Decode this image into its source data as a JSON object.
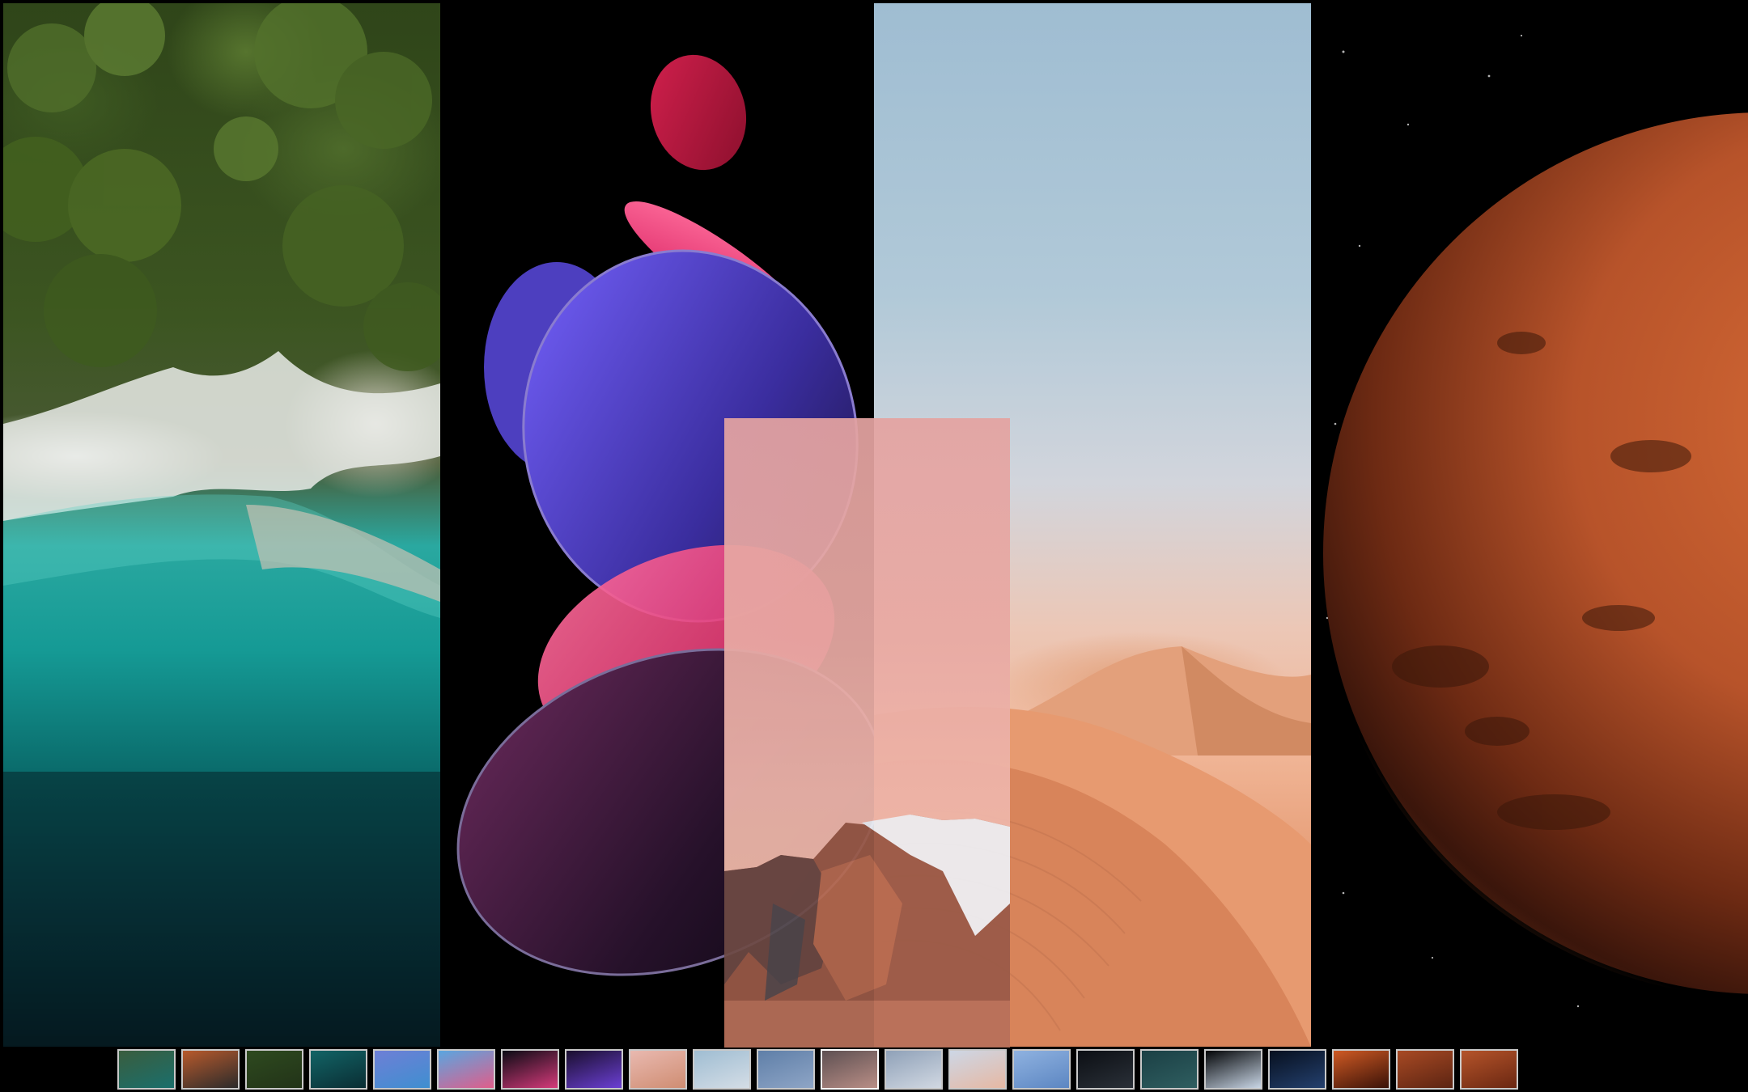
{
  "viewer": {
    "wallpapers": [
      {
        "id": "coast",
        "icon": "aerial-coast-wallpaper"
      },
      {
        "id": "discs",
        "icon": "glass-discs-wallpaper"
      },
      {
        "id": "desert",
        "icon": "desert-dunes-wallpaper"
      },
      {
        "id": "mars",
        "icon": "mars-planet-wallpaper"
      },
      {
        "id": "mountain",
        "icon": "mountain-peak-wallpaper"
      }
    ],
    "thumbnails": [
      {
        "scene": "coast-cliff",
        "colors": [
          "#3a5d3e",
          "#1a6f6c"
        ]
      },
      {
        "scene": "mars-swirl",
        "colors": [
          "#b85a2c",
          "#2b2b2b"
        ]
      },
      {
        "scene": "forest",
        "colors": [
          "#2e4a1f",
          "#223318"
        ]
      },
      {
        "scene": "teal-water",
        "colors": [
          "#126466",
          "#0a2d33"
        ]
      },
      {
        "scene": "discs-blue",
        "colors": [
          "#6e7fd6",
          "#3f8fd0"
        ]
      },
      {
        "scene": "discs-pink-blue",
        "colors": [
          "#5aa6e0",
          "#e05d8a"
        ]
      },
      {
        "scene": "discs-dark",
        "colors": [
          "#0b0b14",
          "#d53a7a"
        ]
      },
      {
        "scene": "discs-purple",
        "colors": [
          "#1a0f2e",
          "#6b3fd4"
        ]
      },
      {
        "scene": "desert-pink",
        "colors": [
          "#e9b9b0",
          "#cf8d72"
        ]
      },
      {
        "scene": "sky-blue",
        "colors": [
          "#9fbdd2",
          "#d4dde6"
        ]
      },
      {
        "scene": "blue-gray",
        "colors": [
          "#5f7fa8",
          "#8ea5c6"
        ]
      },
      {
        "scene": "dusk-lake",
        "colors": [
          "#5e5052",
          "#b98e86"
        ]
      },
      {
        "scene": "pale-sky",
        "colors": [
          "#8fa1b8",
          "#d1d8e2"
        ]
      },
      {
        "scene": "pink-sand",
        "colors": [
          "#cdd7e6",
          "#e6b8a3"
        ]
      },
      {
        "scene": "blue-dunes",
        "colors": [
          "#8fb2e0",
          "#5c86c2"
        ]
      },
      {
        "scene": "dark-dune",
        "colors": [
          "#0c0f14",
          "#2a3038"
        ]
      },
      {
        "scene": "teal-rocks",
        "colors": [
          "#1b4045",
          "#2f5e60"
        ]
      },
      {
        "scene": "planet-arc",
        "colors": [
          "#030507",
          "#c9d6e6"
        ]
      },
      {
        "scene": "night-planet",
        "colors": [
          "#07101f",
          "#24406e"
        ]
      },
      {
        "scene": "mars-orange",
        "colors": [
          "#cf5a24",
          "#3a1208"
        ]
      },
      {
        "scene": "mars-rust",
        "colors": [
          "#a84a24",
          "#5c2412"
        ]
      },
      {
        "scene": "mars-dark",
        "colors": [
          "#b5542a",
          "#6a2712"
        ]
      }
    ],
    "active_thumbnail": 11
  }
}
